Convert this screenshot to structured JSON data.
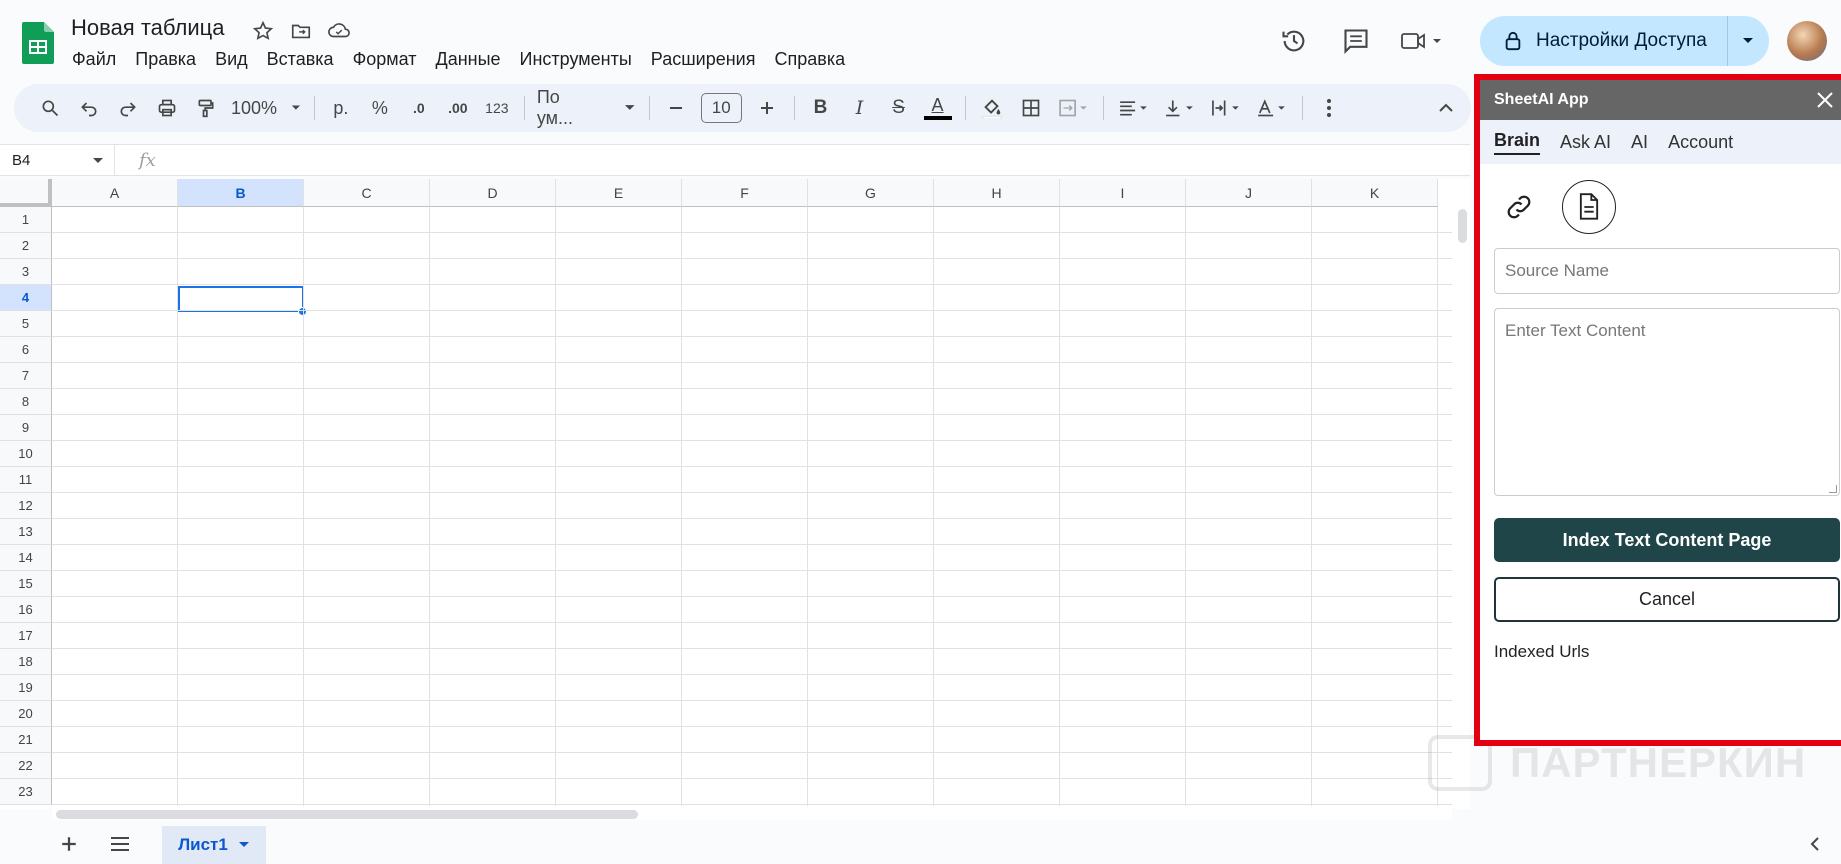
{
  "doc": {
    "title": "Новая таблица"
  },
  "menu": [
    "Файл",
    "Правка",
    "Вид",
    "Вставка",
    "Формат",
    "Данные",
    "Инструменты",
    "Расширения",
    "Справка"
  ],
  "header": {
    "share_label": "Настройки Доступа"
  },
  "toolbar": {
    "zoom": "100%",
    "currency": "р.",
    "percent": "%",
    "dec_less": ".0",
    "dec_more": ".00",
    "format_num": "123",
    "font": "По ум...",
    "font_size": "10",
    "bold": "B",
    "italic": "I",
    "strike": "S",
    "text_color_label": "A"
  },
  "formula": {
    "cell_ref": "B4",
    "fx": "fx"
  },
  "grid": {
    "columns": [
      "A",
      "B",
      "C",
      "D",
      "E",
      "F",
      "G",
      "H",
      "I",
      "J",
      "K"
    ],
    "rows": [
      "1",
      "2",
      "3",
      "4",
      "5",
      "6",
      "7",
      "8",
      "9",
      "10",
      "11",
      "12",
      "13",
      "14",
      "15",
      "16",
      "17",
      "18",
      "19",
      "20",
      "21",
      "22",
      "23"
    ],
    "selected_col": "B",
    "selected_row": "4"
  },
  "sheets": {
    "active_tab": "Лист1"
  },
  "panel": {
    "title": "SheetAI App",
    "tabs": [
      "Brain",
      "Ask AI",
      "AI",
      "Account"
    ],
    "active_tab": "Brain",
    "source_placeholder": "Source Name",
    "content_placeholder": "Enter Text Content",
    "index_button": "Index Text Content Page",
    "cancel_button": "Cancel",
    "indexed_label": "Indexed Urls"
  },
  "watermark": {
    "text": "ПАРТНЕРКИН"
  },
  "colors": {
    "accent": "#0b57d0",
    "panel_border": "#e30012",
    "primary_button": "#1f4548",
    "share_bg": "#c2e7ff"
  }
}
